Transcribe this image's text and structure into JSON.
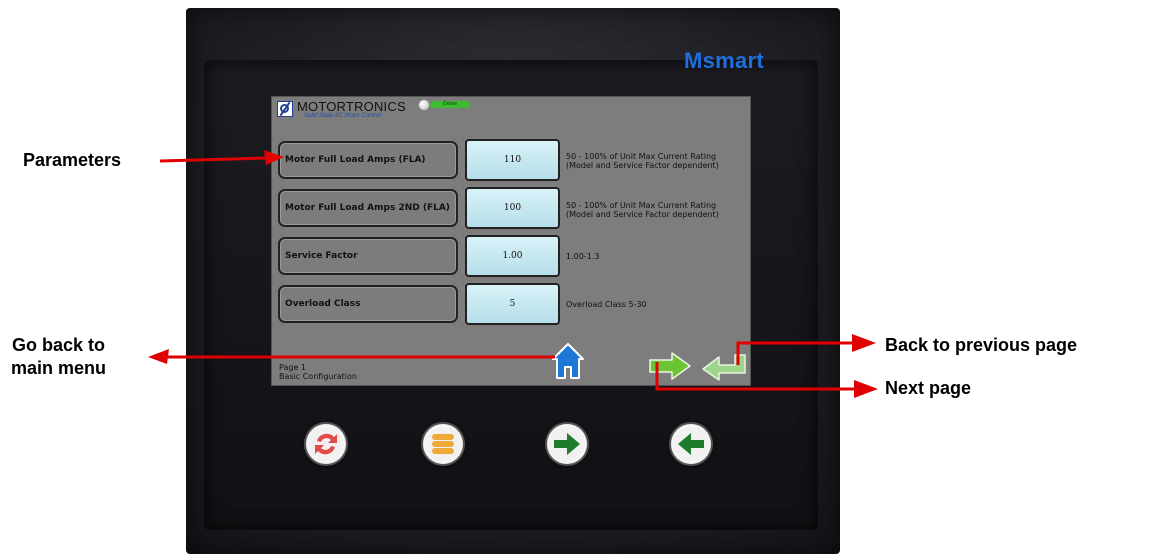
{
  "device": {
    "brand": "Msmart"
  },
  "screen": {
    "header": {
      "title": "MOTORTRONICS",
      "subtitle": "Solid State AC Motor Control",
      "status": "Online"
    },
    "params": [
      {
        "label": "Motor Full Load Amps (FLA)",
        "value": "110",
        "range_line1": "50 - 100% of Unit Max Current Rating",
        "range_line2": "(Model and Service Factor dependent)"
      },
      {
        "label": "Motor Full Load Amps 2ND (FLA)",
        "value": "100",
        "range_line1": "50 - 100% of Unit Max Current Rating",
        "range_line2": "(Model and Service Factor dependent)"
      },
      {
        "label": "Service Factor",
        "value": "1.00",
        "range_line1": "1.00-1.3",
        "range_line2": ""
      },
      {
        "label": "Overload Class",
        "value": "5",
        "range_line1": "Overload Class 5-30",
        "range_line2": ""
      }
    ],
    "footer": {
      "page": "Page 1",
      "section": "Basic Configuration"
    },
    "nav": {
      "home": "home-icon",
      "next": "right-arrow-icon",
      "back": "return-arrow-icon"
    }
  },
  "hardware_buttons": [
    "refresh-icon",
    "menu-icon",
    "right-arrow-icon",
    "left-arrow-icon"
  ],
  "annotations": {
    "parameters": "Parameters",
    "go_back_line1": "Go back to",
    "go_back_line2": "main menu",
    "back_prev": "Back to previous page",
    "next_page": "Next page"
  },
  "colors": {
    "arrow": "#e00000",
    "brand": "#1e6fe0",
    "nav_green": "#6cc334",
    "home_blue": "#1e78d8"
  }
}
